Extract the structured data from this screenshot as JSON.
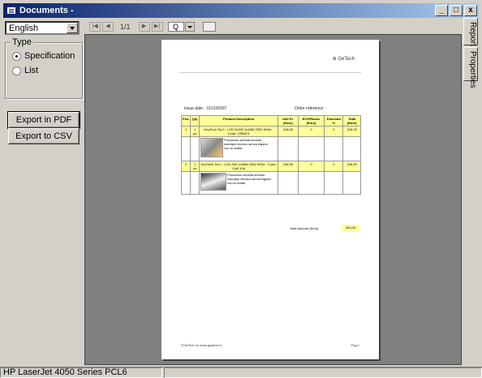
{
  "window": {
    "title": "Documents -",
    "min": "_",
    "max": "□",
    "close": "x"
  },
  "left": {
    "language": "English",
    "type_group": {
      "legend": "Type",
      "options": [
        "Specification",
        "List"
      ],
      "selected": "Specification"
    },
    "export_pdf": "Export in PDF",
    "export_csv": "Export to CSV"
  },
  "toolbar": {
    "first": "|◀",
    "prev": "◀",
    "page": "1/1",
    "next": "▶",
    "last": "▶|",
    "zoom": "Q"
  },
  "tabs": [
    "Report",
    "Properties"
  ],
  "report": {
    "logo": "⊕ GeTech",
    "issue": "Issue date : 31/10/2007",
    "order": "Order reference :",
    "headers": [
      "Pos.",
      "Qty.",
      "Product Description",
      "Unit Pr. (Euro)",
      "ECOPlaces (Euro)",
      "Discount %",
      "Total (Euro)"
    ],
    "rows": [
      {
        "pos": "1",
        "qty": "1 pz",
        "desc": "GeyTech TcL0 - LXD-2x150 1x18W 230V 50Hz - Code: CR6873",
        "unit": "218,00",
        "eco": "0",
        "disc": "0",
        "total": "218,00",
        "note": "Productos scheda tecnica esempio tecnico senza legami con la realta"
      },
      {
        "pos": "2",
        "qty": "1 pz",
        "desc": "GeyTech TcL0 - LXD-150 1x28W 230V 50Hz - Code: CuB 106",
        "unit": "245,00",
        "eco": "0",
        "disc": "0",
        "total": "245,00",
        "note": "Productos scheda tecnica esempio tecnico senza legami con la realta"
      }
    ],
    "total_label": "Total Amount (Euro)",
    "total_value": "463,00",
    "footer": "©GeTech srl www.geytech.it",
    "pagenum": "Pag.1"
  },
  "status": {
    "printer": "HP LaserJet 4050 Series PCL6"
  }
}
